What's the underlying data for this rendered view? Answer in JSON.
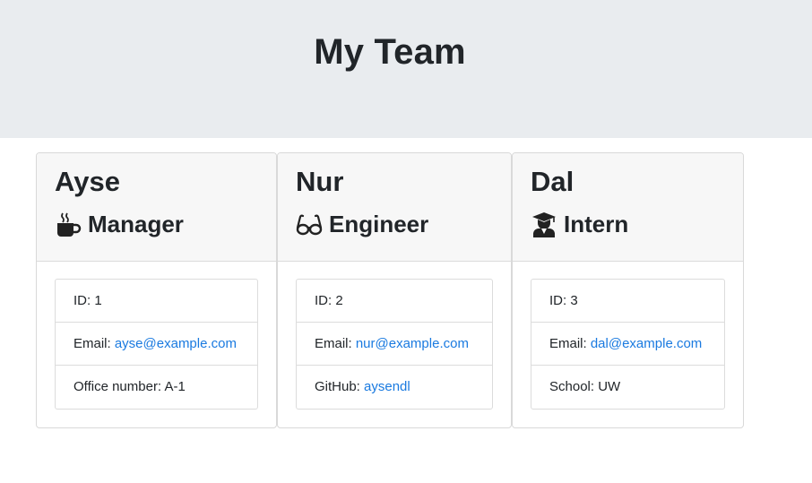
{
  "header": {
    "title": "My Team"
  },
  "colors": {
    "header_bg": "#e9ecef",
    "link": "#1a7ae0"
  },
  "cards": [
    {
      "name": "Ayse",
      "role": "Manager",
      "role_icon": "coffee-mug-icon",
      "id_text": "ID: 1",
      "email_label": "Email: ",
      "email": "ayse@example.com",
      "extra_label": "Office number: A-1",
      "extra_link": ""
    },
    {
      "name": "Nur",
      "role": "Engineer",
      "role_icon": "glasses-icon",
      "id_text": "ID: 2",
      "email_label": "Email: ",
      "email": "nur@example.com",
      "extra_label": "GitHub: ",
      "extra_link": "aysendl"
    },
    {
      "name": "Dal",
      "role": "Intern",
      "role_icon": "graduate-icon",
      "id_text": "ID: 3",
      "email_label": "Email: ",
      "email": "dal@example.com",
      "extra_label": "School: UW",
      "extra_link": ""
    }
  ]
}
